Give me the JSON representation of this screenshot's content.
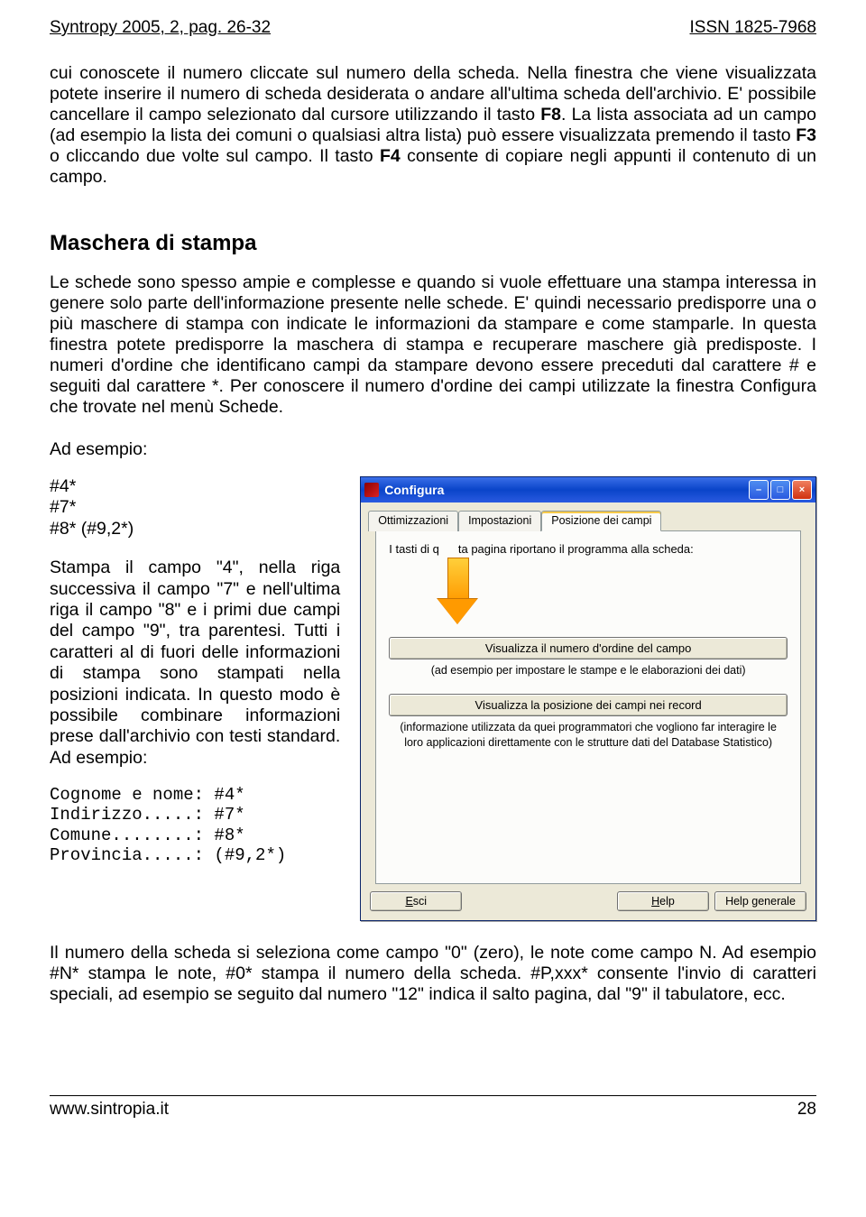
{
  "header": {
    "left": "Syntropy 2005, 2, pag. 26-32",
    "right": "ISSN 1825-7968"
  },
  "para1_a": "cui conoscete il numero cliccate sul numero della scheda. Nella finestra che viene visualizzata potete inserire il numero di scheda desiderata o andare all'ultima scheda dell'archivio. E' possibile cancellare il campo selezionato dal cursore utilizzando il tasto ",
  "para1_b": ". La lista associata ad un campo (ad esempio la lista dei comuni o qualsiasi altra lista) può essere visualizzata premendo il tasto ",
  "para1_c": " o cliccando due volte sul campo. Il tasto ",
  "para1_d": " consente di copiare negli appunti il contenuto di un campo.",
  "f8": "F8",
  "f3": "F3",
  "f4": "F4",
  "heading": "Maschera di stampa",
  "para2": "Le schede sono spesso ampie e complesse e quando si vuole effettuare una stampa interessa in genere solo parte dell'informazione presente nelle schede. E' quindi necessario predisporre una o più maschere di stampa con indicate le informazioni da stampare e come stamparle. In questa finestra potete predisporre la maschera di stampa e recuperare maschere già predisposte. I numeri d'ordine che identificano campi da stampare devono essere preceduti dal carattere # e seguiti dal carattere *. Per conoscere il numero d'ordine dei campi utilizzate la finestra Configura che trovate nel menù Schede.",
  "ad_esempio": "Ad esempio:",
  "codes": [
    "#4*",
    "#7*",
    "#8* (#9,2*)"
  ],
  "left_para1": "Stampa il campo \"4\", nella riga successiva il campo \"7\" e nell'ultima riga il campo \"8\" e i primi due campi del campo \"9\", tra parentesi. Tutti i caratteri al di fuori delle informazioni di stampa sono stampati nella posizioni indicata. In questo modo è possibile combinare informazioni prese dall'archivio con testi standard. Ad esempio:",
  "mono_lines": [
    "Cognome e nome: #4*",
    "Indirizzo.....: #7*",
    "Comune........: #8*",
    "Provincia.....: (#9,2*)"
  ],
  "dialog": {
    "title": "Configura",
    "tabs": [
      "Ottimizzazioni",
      "Impostazioni",
      "Posizione dei campi"
    ],
    "msg_prefix": "I tasti di q",
    "msg_suffix": "ta pagina riportano il programma alla scheda:",
    "btn1": "Visualizza il numero d'ordine del campo",
    "caption1": "(ad esempio per impostare le stampe e le elaborazioni dei dati)",
    "btn2": "Visualizza la posizione dei campi nei record",
    "caption2": "(informazione utilizzata da quei programmatori che vogliono far interagire le loro applicazioni direttamente con le strutture dati del Database Statistico)",
    "footer": {
      "esci_u": "E",
      "esci_rest": "sci",
      "help_u": "H",
      "help_rest": "elp",
      "helpgen": "Help generale"
    }
  },
  "para3": "Il numero della scheda si seleziona come campo \"0\" (zero), le note come campo N. Ad esempio #N* stampa le note, #0* stampa il numero della scheda. #P,xxx* consente l'invio di caratteri speciali, ad esempio se seguito dal numero \"12\" indica il salto pagina, dal \"9\" il tabulatore, ecc.",
  "footer": {
    "left": "www.sintropia.it",
    "right": "28"
  }
}
